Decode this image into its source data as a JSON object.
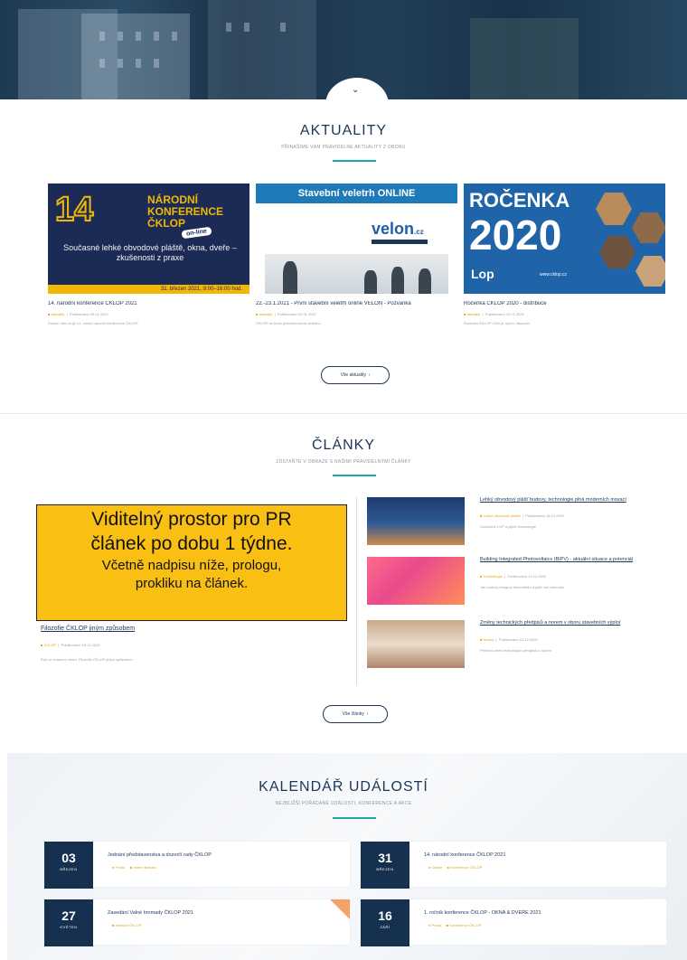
{
  "hero": {
    "chevron": "⌄"
  },
  "news": {
    "title": "AKTUALITY",
    "subtitle": "PŘINÁŠÍME VÁM PRAVIDELNÉ AKTUALITY Z OBORU",
    "cards": [
      {
        "image": {
          "number": "14",
          "heading": "NÁRODNÍ KONFERENCE ČKLOP",
          "badge": "on-line",
          "text": "Současné lehké obvodové pláště, okna, dveře – zkušenosti z praxe",
          "date": "31. březen 2021, 9:00–16:00 hod."
        },
        "title": "14. národní konference ČKLOP 2021",
        "category": "Aktuality",
        "meta": "Publikováno 26.01.2021",
        "text": "Zveme Vás na již 14. ročník národní konference ČKLOP"
      },
      {
        "image": {
          "band": "Stavební veletrh ONLINE",
          "logo": "velon",
          "logo_suffix": ".cz"
        },
        "title": "22.-23.1.2021 - První stavební veletrh online VELON - Pozvánka",
        "category": "Aktuality",
        "meta": "Publikováno 20.01.2021",
        "text": "ČKLOP se bude prezentovat na veletrhu"
      },
      {
        "image": {
          "title": "ROČENKA",
          "year": "2020",
          "logo": "Lop",
          "url": "www.cklop.cz"
        },
        "title": "Ročenka ČKLOP 2020 - distribuce",
        "category": "Aktuality",
        "meta": "Publikováno 12.01.2021",
        "text": "Ročenka ČKLOP 2020 je nyní k dispozici"
      }
    ],
    "button": "Vše aktuality"
  },
  "articles": {
    "title": "ČLÁNKY",
    "subtitle": "ZŮSTAŇTE V OBRAZE S NAŠIMI PRAVIDELNÝMI ČLÁNKY",
    "pr_box": {
      "line1": "Viditelný prostor pro PR",
      "line2": "článek po dobu 1 týdne.",
      "line3": "Včetně nadpisu níže, prologu,",
      "line4": "prokliku na článek."
    },
    "main": {
      "title": "Filozofie ČKLOP jiným způsobem",
      "category": "ČKLOP",
      "meta": "Publikováno 18.12.2020",
      "text": "Rok ve znamení změn. Filozofie ČKLOP jiným způsobem"
    },
    "side": [
      {
        "title": "Lehký obvodový plášť budovy, technologie plná moderních inovací",
        "category": "Lehké obvodové pláště",
        "meta": "Publikováno 18.12.2020",
        "text": "Současné LOP a jejich technologie"
      },
      {
        "title": "Building Integrated Photovoltaics (BIPV) - aktuální situace a potenciál",
        "category": "Technologie",
        "meta": "Publikováno 10.12.2020",
        "text": "Jak budovy integrují fotovoltaiku a jaké má potenciál"
      },
      {
        "title": "Změny technických předpisů a norem v oboru stavebních výplní",
        "category": "Normy",
        "meta": "Publikováno 01.12.2020",
        "text": "Přehled změn technických předpisů a norem"
      }
    ],
    "button": "Vše články"
  },
  "calendar": {
    "title": "KALENDÁŘ UDÁLOSTÍ",
    "subtitle": "NEJBLIŽŠÍ POŘÁDANÉ UDÁLOSTI, KONFERENCE A AKCE",
    "events": [
      {
        "day": "03",
        "month": "BŘEZEN",
        "title": "Jednání představenstva a dozorčí rady ČKLOP",
        "place": "Praha",
        "type": "Interní jednání"
      },
      {
        "day": "31",
        "month": "BŘEZEN",
        "title": "14. národní konference ČKLOP 2021",
        "place": "Online",
        "type": "Konference ČKLOP"
      },
      {
        "day": "27",
        "month": "KVĚTEN",
        "title": "Zasedání Valné hromady ČKLOP 2021",
        "place": "",
        "type": "Jednání ČKLOP"
      },
      {
        "day": "16",
        "month": "ZÁŘÍ",
        "title": "1. ročník konference ČKLOP - OKNA & DVEŘE 2021",
        "place": "Praha",
        "type": "Konference ČKLOP"
      }
    ]
  },
  "colors": {
    "accent": "#1fa6a6",
    "navy": "#16304f",
    "pr_yellow": "#f9c013",
    "tag_orange": "#e8a317"
  }
}
